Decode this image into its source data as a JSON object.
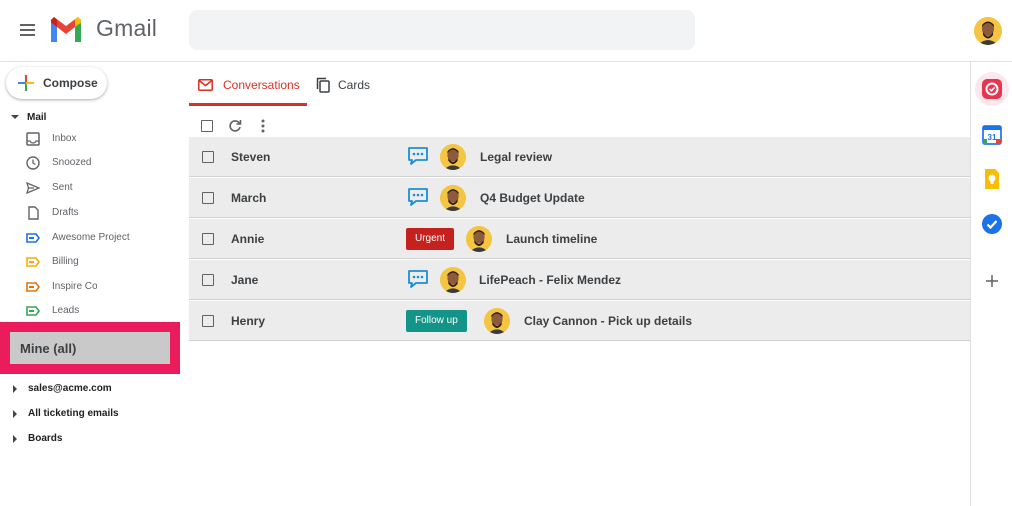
{
  "header": {
    "app_name": "Gmail",
    "search_placeholder": ""
  },
  "compose": {
    "label": "Compose"
  },
  "sidebar": {
    "mail_section": "Mail",
    "items": [
      {
        "label": "Inbox",
        "icon": "inbox-icon"
      },
      {
        "label": "Snoozed",
        "icon": "clock-icon"
      },
      {
        "label": "Sent",
        "icon": "send-icon"
      },
      {
        "label": "Drafts",
        "icon": "draft-icon"
      },
      {
        "label": "Awesome Project",
        "icon": "label-icon",
        "color": "#1a73e8"
      },
      {
        "label": "Billing",
        "icon": "label-icon",
        "color": "#f9ab00"
      },
      {
        "label": "Inspire Co",
        "icon": "label-icon",
        "color": "#e8710a"
      },
      {
        "label": "Leads",
        "icon": "label-icon",
        "color": "#34a853"
      }
    ],
    "highlighted": "Mine (all)",
    "groups": [
      {
        "label": "sales@acme.com"
      },
      {
        "label": "All ticketing emails"
      },
      {
        "label": "Boards"
      }
    ]
  },
  "tabs": [
    {
      "label": "Conversations",
      "active": true
    },
    {
      "label": "Cards",
      "active": false
    }
  ],
  "conversations": [
    {
      "sender": "Steven",
      "marker": "chat",
      "subject": "Legal review"
    },
    {
      "sender": "March",
      "marker": "chat",
      "subject": "Q4 Budget Update"
    },
    {
      "sender": "Annie",
      "marker": "tag",
      "tag": "Urgent",
      "tag_color": "#c5221f",
      "subject": "Launch timeline"
    },
    {
      "sender": "Jane",
      "marker": "chat",
      "subject": "LifePeach - Felix Mendez"
    },
    {
      "sender": "Henry",
      "marker": "tag",
      "tag": "Follow up",
      "tag_color": "#129488",
      "subject": "Clay Cannon - Pick up details"
    }
  ],
  "colors": {
    "accent": "#d93025",
    "highlight_border": "#ea1c5c",
    "highlight_fill": "#c9c9c9",
    "row_bg": "#ececec",
    "chat_icon": "#1a8fd6"
  }
}
